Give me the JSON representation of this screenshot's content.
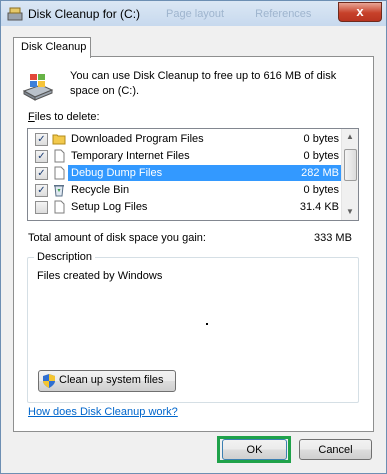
{
  "window": {
    "title": "Disk Cleanup for  (C:)",
    "background_tabs": [
      "Page layout",
      "References"
    ],
    "close_label": "x"
  },
  "tab": {
    "label": "Disk Cleanup"
  },
  "intro": {
    "text": "You can use Disk Cleanup to free up to 616 MB of disk space on  (C:)."
  },
  "files_label": {
    "accel": "F",
    "rest": "iles to delete:"
  },
  "files": [
    {
      "name": "Downloaded Program Files",
      "size": "0 bytes",
      "checked": true,
      "selected": false,
      "icon": "folder-icon"
    },
    {
      "name": "Temporary Internet Files",
      "size": "0 bytes",
      "checked": true,
      "selected": false,
      "icon": "document-icon"
    },
    {
      "name": "Debug Dump Files",
      "size": "282 MB",
      "checked": true,
      "selected": true,
      "icon": "document-icon"
    },
    {
      "name": "Recycle Bin",
      "size": "0 bytes",
      "checked": true,
      "selected": false,
      "icon": "recycle-bin-icon"
    },
    {
      "name": "Setup Log Files",
      "size": "31.4 KB",
      "checked": false,
      "selected": false,
      "icon": "document-icon"
    }
  ],
  "total": {
    "label": "Total amount of disk space you gain:",
    "value": "333 MB"
  },
  "description": {
    "caption": "Description",
    "text": "Files created by Windows"
  },
  "cleanup_system_button": "Clean up system files",
  "help_link": "How does Disk Cleanup work?",
  "buttons": {
    "ok": "OK",
    "cancel": "Cancel"
  },
  "colors": {
    "selection": "#3399ff",
    "link": "#0066cc",
    "highlight_box": "#1fa24a"
  }
}
